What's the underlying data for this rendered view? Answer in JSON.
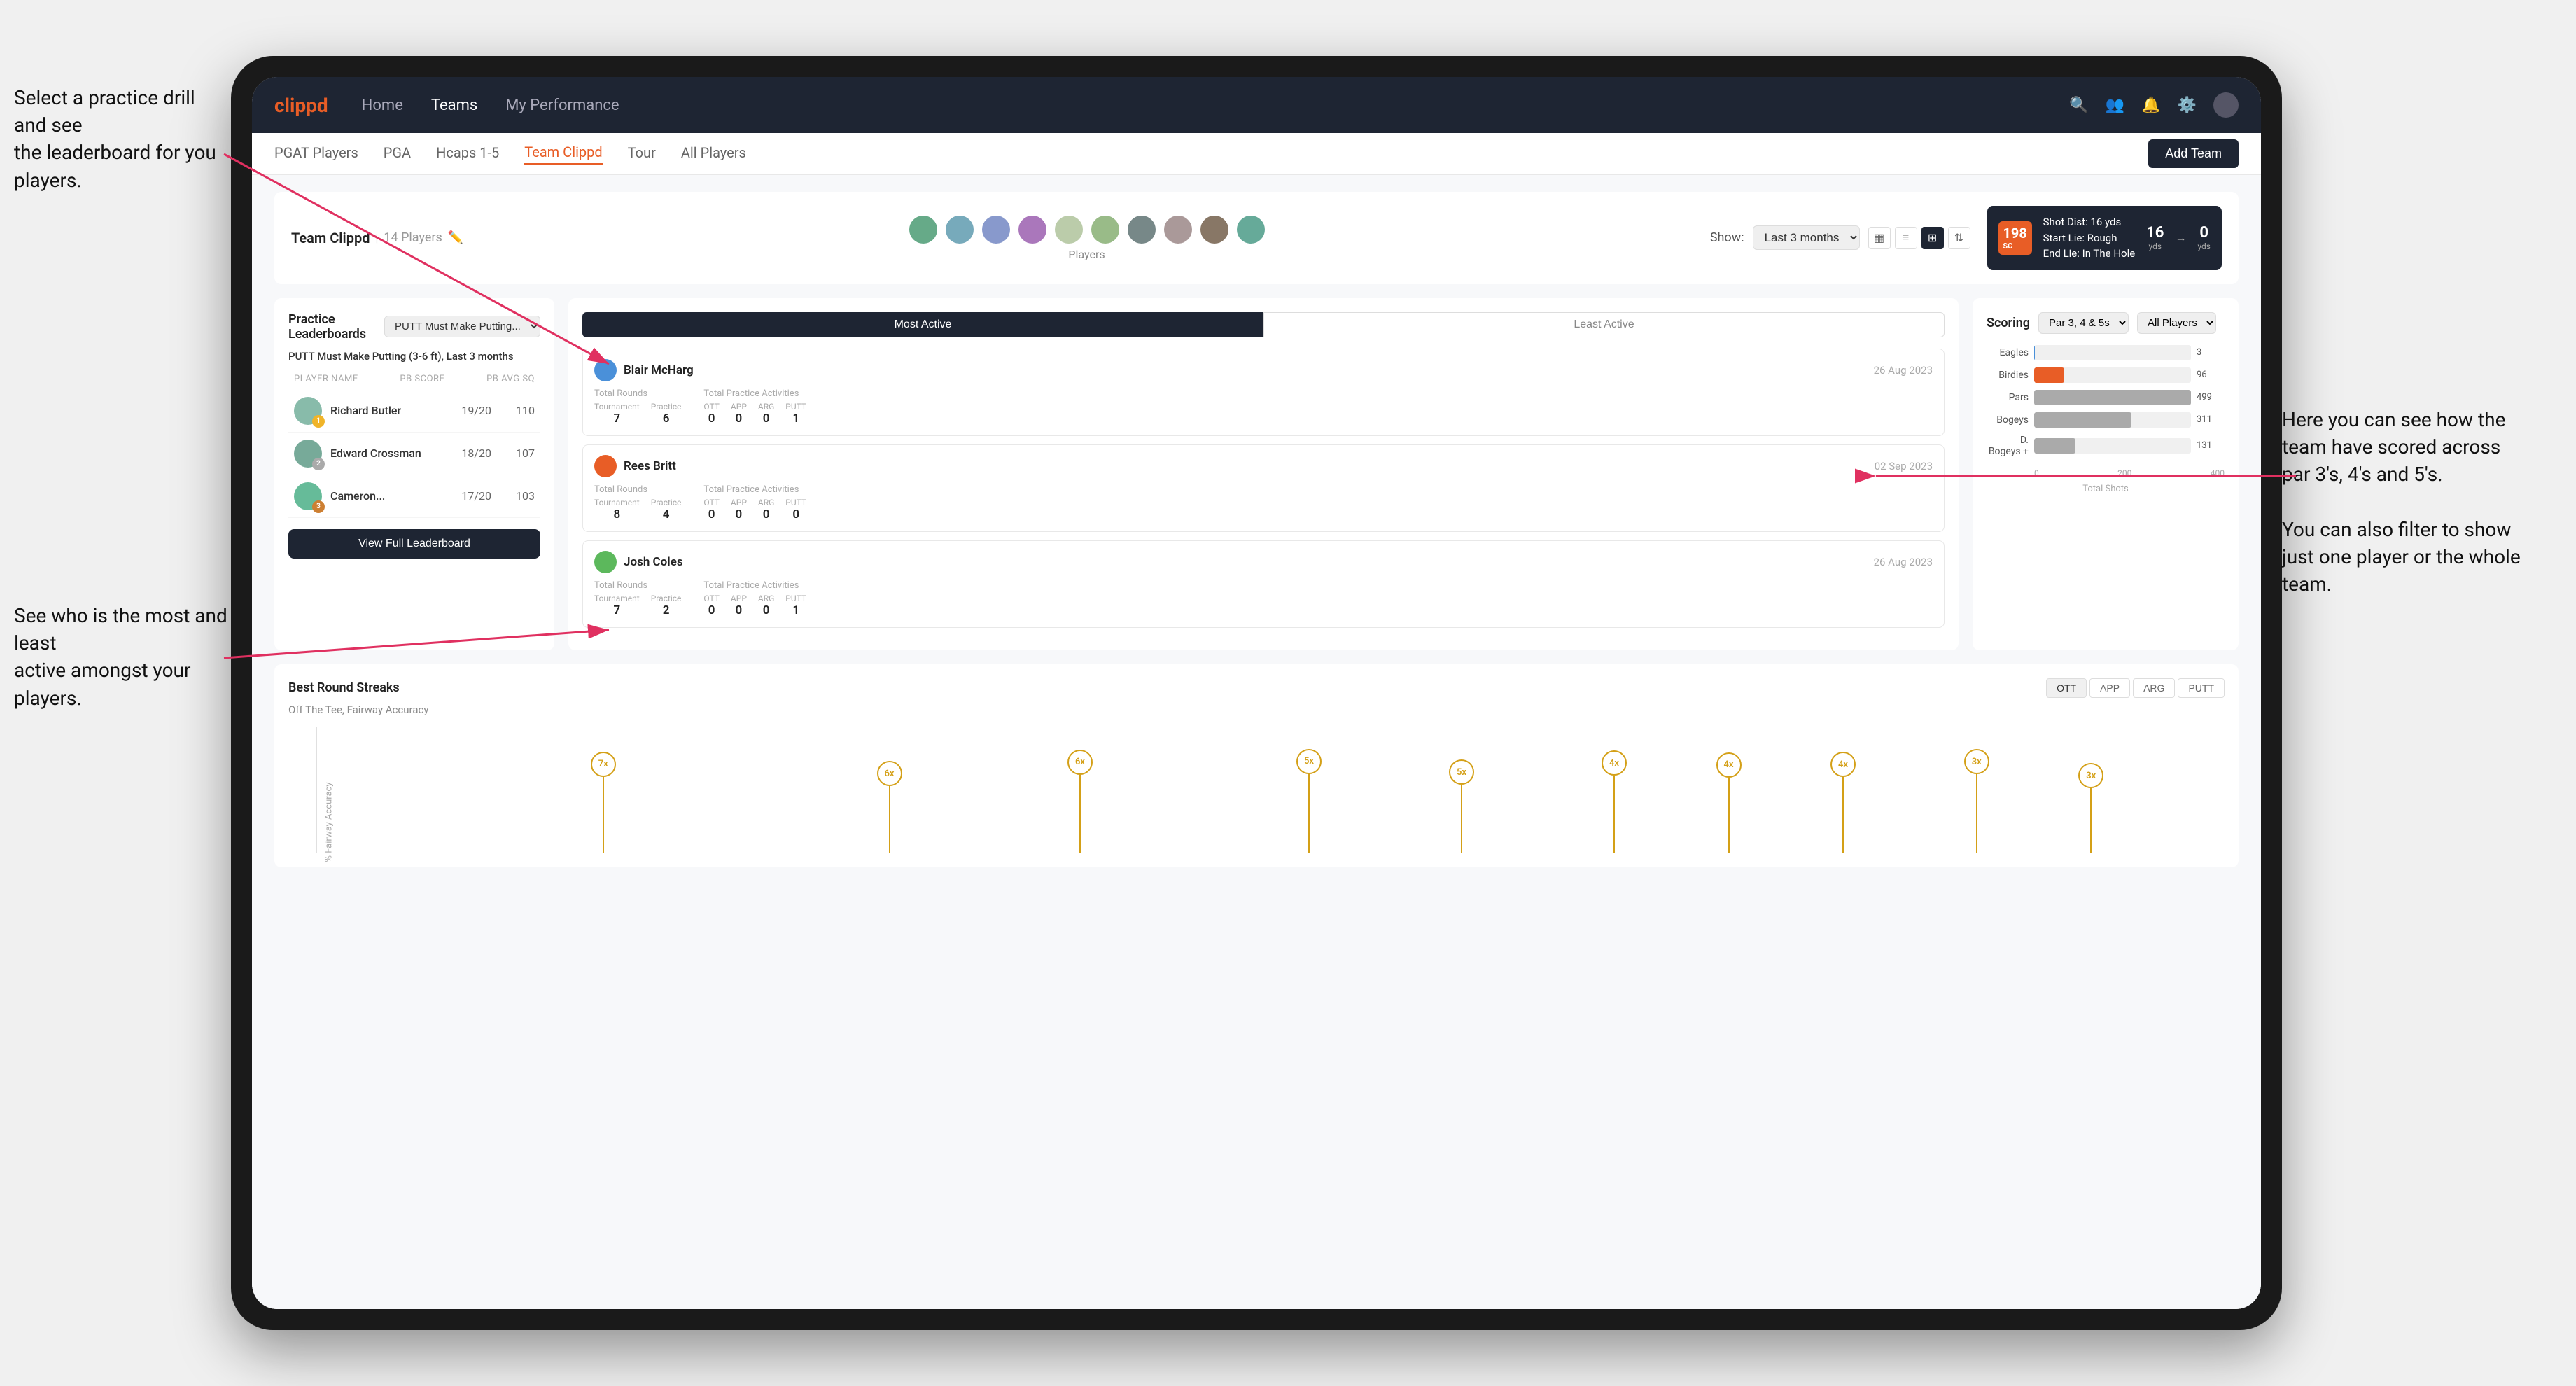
{
  "annotations": {
    "top_left": "Select a practice drill and see\nthe leaderboard for you players.",
    "bottom_left": "See who is the most and least\nactive amongst your players.",
    "top_right": "Here you can see how the\nteam have scored across\npar 3's, 4's and 5's.\n\nYou can also filter to show\njust one player or the whole\nteam."
  },
  "navbar": {
    "logo": "clippd",
    "links": [
      "Home",
      "Teams",
      "My Performance"
    ],
    "active_link": "Teams"
  },
  "subnav": {
    "links": [
      "PGAT Players",
      "PGA",
      "Hcaps 1-5",
      "Team Clippd",
      "Tour",
      "All Players"
    ],
    "active_link": "Team Clippd",
    "add_team_label": "Add Team"
  },
  "team_header": {
    "title": "Team Clippd",
    "count": "14 Players",
    "show_label": "Show:",
    "show_value": "Last 3 months",
    "players_label": "Players"
  },
  "shot_info": {
    "number": "198",
    "unit": "SC",
    "dist_label": "Shot Dist:",
    "dist_value": "16 yds",
    "start_lie_label": "Start Lie:",
    "start_lie_value": "Rough",
    "end_lie_label": "End Lie:",
    "end_lie_value": "In The Hole",
    "yds_from": "16",
    "yds_from_label": "yds",
    "yds_to": "0",
    "yds_to_label": "yds"
  },
  "practice_leaderboards": {
    "title": "Practice Leaderboards",
    "drill_select": "PUTT Must Make Putting...",
    "subtitle": "PUTT Must Make Putting (3-6 ft),",
    "subtitle_period": "Last 3 months",
    "col_player": "PLAYER NAME",
    "col_pb_score": "PB SCORE",
    "col_avg_sq": "PB AVG SQ",
    "players": [
      {
        "name": "Richard Butler",
        "score": "19/20",
        "avg": "110",
        "badge": "gold",
        "badge_num": ""
      },
      {
        "name": "Edward Crossman",
        "score": "18/20",
        "avg": "107",
        "badge": "silver",
        "badge_num": "2"
      },
      {
        "name": "Cameron...",
        "score": "17/20",
        "avg": "103",
        "badge": "bronze",
        "badge_num": "3"
      }
    ],
    "view_full_label": "View Full Leaderboard"
  },
  "activity": {
    "tab_most_active": "Most Active",
    "tab_least_active": "Least Active",
    "active_tab": "Most Active",
    "players": [
      {
        "name": "Blair McHarg",
        "date": "26 Aug 2023",
        "total_rounds_label": "Total Rounds",
        "tournament_label": "Tournament",
        "practice_label": "Practice",
        "tournament_value": "7",
        "practice_value": "6",
        "total_practice_label": "Total Practice Activities",
        "ott_label": "OTT",
        "app_label": "APP",
        "arg_label": "ARG",
        "putt_label": "PUTT",
        "ott_value": "0",
        "app_value": "0",
        "arg_value": "0",
        "putt_value": "1"
      },
      {
        "name": "Rees Britt",
        "date": "02 Sep 2023",
        "total_rounds_label": "Total Rounds",
        "tournament_label": "Tournament",
        "practice_label": "Practice",
        "tournament_value": "8",
        "practice_value": "4",
        "total_practice_label": "Total Practice Activities",
        "ott_label": "OTT",
        "app_label": "APP",
        "arg_label": "ARG",
        "putt_label": "PUTT",
        "ott_value": "0",
        "app_value": "0",
        "arg_value": "0",
        "putt_value": "0"
      },
      {
        "name": "Josh Coles",
        "date": "26 Aug 2023",
        "total_rounds_label": "Total Rounds",
        "tournament_label": "Tournament",
        "practice_label": "Practice",
        "tournament_value": "7",
        "practice_value": "2",
        "total_practice_label": "Total Practice Activities",
        "ott_label": "OTT",
        "app_label": "APP",
        "arg_label": "ARG",
        "putt_label": "PUTT",
        "ott_value": "0",
        "app_value": "0",
        "arg_value": "0",
        "putt_value": "1"
      }
    ]
  },
  "scoring": {
    "title": "Scoring",
    "filter_label": "Par 3, 4 & 5s",
    "players_filter": "All Players",
    "bars": [
      {
        "label": "Eagles",
        "value": 3,
        "max": 500,
        "color": "#4a90d9"
      },
      {
        "label": "Birdies",
        "value": 96,
        "max": 500,
        "color": "#e85d26"
      },
      {
        "label": "Pars",
        "value": 499,
        "max": 500,
        "color": "#aaa"
      },
      {
        "label": "Bogeys",
        "value": 311,
        "max": 500,
        "color": "#aaa"
      },
      {
        "label": "D. Bogeys +",
        "value": 131,
        "max": 500,
        "color": "#aaa"
      }
    ],
    "axis_labels": [
      "0",
      "200",
      "400"
    ],
    "footer": "Total Shots"
  },
  "best_round_streaks": {
    "title": "Best Round Streaks",
    "subtitle": "Off The Tee, Fairway Accuracy",
    "btns": [
      "OTT",
      "APP",
      "ARG",
      "PUTT"
    ],
    "active_btn": "OTT",
    "dots": [
      {
        "label": "7x",
        "pct": 15
      },
      {
        "label": "6x",
        "pct": 30
      },
      {
        "label": "6x",
        "pct": 40
      },
      {
        "label": "5x",
        "pct": 52
      },
      {
        "label": "5x",
        "pct": 60
      },
      {
        "label": "4x",
        "pct": 68
      },
      {
        "label": "4x",
        "pct": 74
      },
      {
        "label": "4x",
        "pct": 80
      },
      {
        "label": "3x",
        "pct": 87
      },
      {
        "label": "3x",
        "pct": 93
      }
    ]
  }
}
